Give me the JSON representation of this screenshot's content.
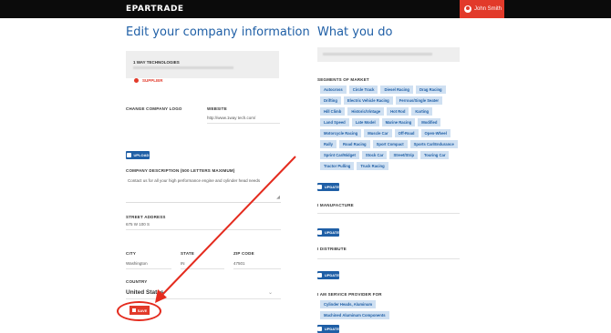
{
  "header": {
    "logo": "EPARTRADE",
    "user_name": "John Smith"
  },
  "left": {
    "title": "Edit your company information",
    "company_name": "1 WAY TECHNOLOGIES",
    "supplier_badge": "SUPPLIER",
    "change_logo_label": "CHANGE COMPANY LOGO",
    "website_label": "WEBSITE",
    "website_value": "http://www.1way tech.com/",
    "upload_label": "UPLOAD",
    "description_label": "COMPANY DESCRIPTION (500 LETTERS MAXIMUM)",
    "description_value": "Contact us for all your high performance engine and cylinder head needs",
    "street_label": "STREET ADDRESS",
    "street_value": "675 W 100 S",
    "city_label": "CITY",
    "city_value": "Washington",
    "state_label": "STATE",
    "state_value": "IN",
    "zip_label": "ZIP CODE",
    "zip_value": "47501",
    "country_label": "COUNTRY",
    "country_value": "United States",
    "save_label": "SAVE"
  },
  "right": {
    "title": "What you do",
    "segments_label": "SEGMENTS OF MARKET",
    "segments": [
      "Autocross",
      "Circle Track",
      "Diesel Racing",
      "Drag Racing",
      "Drifting",
      "Electric Vehicle Racing",
      "Ferrous/Single Seater",
      "Hill Climb",
      "Historic/Vintage",
      "Hot Rod",
      "Karting",
      "Land Speed",
      "Late Model",
      "Marine Racing",
      "Modified",
      "Motorcycle Racing",
      "Muscle Car",
      "Off-Road",
      "Open-Wheel",
      "Rally",
      "Road Racing",
      "Sport Compact",
      "Sports Car/Endurance",
      "Sprint Car/Midget",
      "Stock Car",
      "Street/Strip",
      "Touring Car",
      "Tractor Pulling",
      "Truck Racing"
    ],
    "update_label": "UPDATE",
    "manufacture_label": "I MANUFACTURE",
    "distribute_label": "I DISTRIBUTE",
    "service_label": "I AM SERVICE PROVIDER FOR",
    "service_items": [
      "Cylinder Heads, Aluminum",
      "Machined Aluminum Components"
    ]
  },
  "colors": {
    "accent": "#1f5fa6",
    "danger": "#e23a2a",
    "topbar": "#0b0b0b"
  }
}
